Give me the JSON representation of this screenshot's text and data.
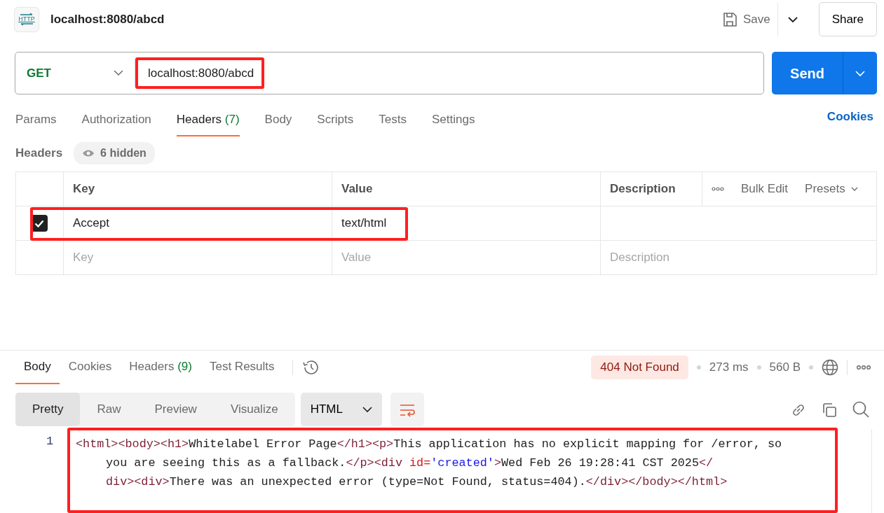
{
  "request": {
    "icon_text": "HTTP",
    "title": "localhost:8080/abcd",
    "save_label": "Save",
    "share_label": "Share",
    "method": "GET",
    "url": "localhost:8080/abcd",
    "url_highlighted": true,
    "send_label": "Send"
  },
  "request_tabs": [
    {
      "label": "Params",
      "selected": false
    },
    {
      "label": "Authorization",
      "selected": false
    },
    {
      "label": "Headers",
      "count": "(7)",
      "selected": true
    },
    {
      "label": "Body",
      "selected": false
    },
    {
      "label": "Scripts",
      "selected": false
    },
    {
      "label": "Tests",
      "selected": false
    },
    {
      "label": "Settings",
      "selected": false
    }
  ],
  "cookies_link": "Cookies",
  "headers_section": {
    "title": "Headers",
    "hidden_label": "6 hidden"
  },
  "headers_table": {
    "columns": [
      "Key",
      "Value",
      "Description"
    ],
    "actions": [
      "Bulk Edit",
      "Presets"
    ],
    "rows": [
      {
        "key": "Accept",
        "value": "text/html",
        "checked": true,
        "highlighted": true
      }
    ],
    "placeholders": {
      "key": "Key",
      "value": "Value",
      "description": "Description"
    }
  },
  "response_tabs": [
    {
      "label": "Body",
      "selected": true
    },
    {
      "label": "Cookies",
      "selected": false
    },
    {
      "label": "Headers",
      "count": "(9)",
      "selected": false
    },
    {
      "label": "Test Results",
      "selected": false
    }
  ],
  "response_meta": {
    "status": "404 Not Found",
    "time": "273 ms",
    "size": "560 B"
  },
  "view_modes": [
    {
      "label": "Pretty",
      "selected": true
    },
    {
      "label": "Raw",
      "selected": false
    },
    {
      "label": "Preview",
      "selected": false
    },
    {
      "label": "Visualize",
      "selected": false
    }
  ],
  "format": "HTML",
  "code": {
    "line_number": "1",
    "highlighted": true,
    "wrapped_lines": [
      [
        {
          "kind": "tag",
          "text": "<html><body><h1>"
        },
        {
          "kind": "text",
          "text": "Whitelabel Error Page"
        },
        {
          "kind": "tag",
          "text": "</h1><p>"
        },
        {
          "kind": "text",
          "text": "This application has no explicit mapping for /error, so"
        }
      ],
      [
        {
          "kind": "text",
          "text": "you are seeing this as a fallback."
        },
        {
          "kind": "tag",
          "text": "</p><div "
        },
        {
          "kind": "attr",
          "text": "id="
        },
        {
          "kind": "string",
          "text": "'created'"
        },
        {
          "kind": "tag",
          "text": ">"
        },
        {
          "kind": "text",
          "text": "Wed Feb 26 19:28:41 CST 2025"
        },
        {
          "kind": "tag",
          "text": "</"
        }
      ],
      [
        {
          "kind": "tag",
          "text": "div><div>"
        },
        {
          "kind": "text",
          "text": "There was an unexpected error (type=Not Found, status=404)."
        },
        {
          "kind": "tag",
          "text": "</div></body></html>"
        }
      ]
    ]
  }
}
